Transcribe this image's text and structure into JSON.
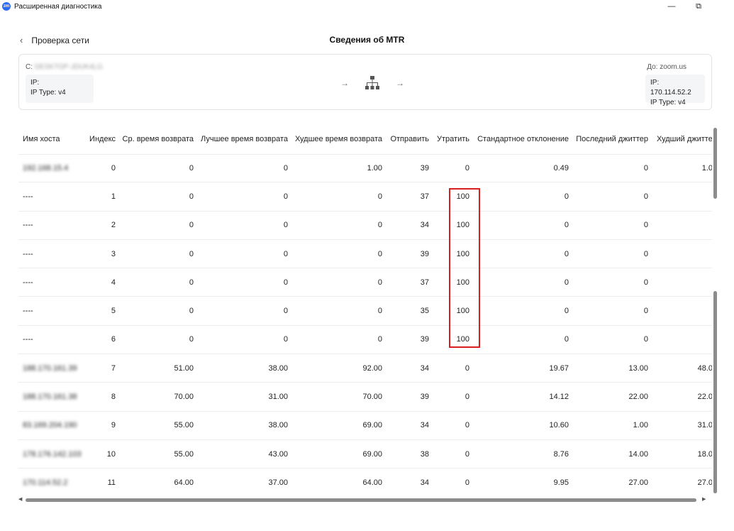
{
  "window": {
    "title": "Расширенная диагностика",
    "app_icon_text": "zm",
    "minimize": "—",
    "restore": "⧉"
  },
  "header": {
    "back_label": "Проверка сети",
    "page_title": "Сведения об MTR"
  },
  "route": {
    "from_prefix": "С:",
    "from_host": "DESKTOP-JDUK4LG",
    "from_ip": "IP:",
    "from_ip_type": "IP Type: v4",
    "to_label": "До: zoom.us",
    "to_ip": "IP: 170.114.52.2",
    "to_ip_type": "IP Type: v4"
  },
  "table": {
    "columns": [
      "Имя хоста",
      "Индекс",
      "Ср. время возврата",
      "Лучшее время возврата",
      "Худшее время возврата",
      "Отправить",
      "Утратить",
      "Стандартное отклонение",
      "Последний джиттер",
      "Худший джитте"
    ],
    "rows": [
      {
        "host": "192.168.15.4",
        "blurred": true,
        "index": "0",
        "avg": "0",
        "best": "0",
        "worst": "1.00",
        "sent": "39",
        "lost": "0",
        "stdev": "0.49",
        "last_jitter": "0",
        "worst_jitter": "1.0"
      },
      {
        "host": "----",
        "blurred": false,
        "index": "1",
        "avg": "0",
        "best": "0",
        "worst": "0",
        "sent": "37",
        "lost": "100",
        "stdev": "0",
        "last_jitter": "0",
        "worst_jitter": ""
      },
      {
        "host": "----",
        "blurred": false,
        "index": "2",
        "avg": "0",
        "best": "0",
        "worst": "0",
        "sent": "34",
        "lost": "100",
        "stdev": "0",
        "last_jitter": "0",
        "worst_jitter": ""
      },
      {
        "host": "----",
        "blurred": false,
        "index": "3",
        "avg": "0",
        "best": "0",
        "worst": "0",
        "sent": "39",
        "lost": "100",
        "stdev": "0",
        "last_jitter": "0",
        "worst_jitter": ""
      },
      {
        "host": "----",
        "blurred": false,
        "index": "4",
        "avg": "0",
        "best": "0",
        "worst": "0",
        "sent": "37",
        "lost": "100",
        "stdev": "0",
        "last_jitter": "0",
        "worst_jitter": ""
      },
      {
        "host": "----",
        "blurred": false,
        "index": "5",
        "avg": "0",
        "best": "0",
        "worst": "0",
        "sent": "35",
        "lost": "100",
        "stdev": "0",
        "last_jitter": "0",
        "worst_jitter": ""
      },
      {
        "host": "----",
        "blurred": false,
        "index": "6",
        "avg": "0",
        "best": "0",
        "worst": "0",
        "sent": "39",
        "lost": "100",
        "stdev": "0",
        "last_jitter": "0",
        "worst_jitter": ""
      },
      {
        "host": "188.170.161.39",
        "blurred": true,
        "index": "7",
        "avg": "51.00",
        "best": "38.00",
        "worst": "92.00",
        "sent": "34",
        "lost": "0",
        "stdev": "19.67",
        "last_jitter": "13.00",
        "worst_jitter": "48.0"
      },
      {
        "host": "188.170.161.38",
        "blurred": true,
        "index": "8",
        "avg": "70.00",
        "best": "31.00",
        "worst": "70.00",
        "sent": "39",
        "lost": "0",
        "stdev": "14.12",
        "last_jitter": "22.00",
        "worst_jitter": "22.0"
      },
      {
        "host": "83.169.204.190",
        "blurred": true,
        "index": "9",
        "avg": "55.00",
        "best": "38.00",
        "worst": "69.00",
        "sent": "34",
        "lost": "0",
        "stdev": "10.60",
        "last_jitter": "1.00",
        "worst_jitter": "31.0"
      },
      {
        "host": "178.176.142.103",
        "blurred": true,
        "index": "10",
        "avg": "55.00",
        "best": "43.00",
        "worst": "69.00",
        "sent": "38",
        "lost": "0",
        "stdev": "8.76",
        "last_jitter": "14.00",
        "worst_jitter": "18.0"
      },
      {
        "host": "170.114.52.2",
        "blurred": true,
        "index": "11",
        "avg": "64.00",
        "best": "37.00",
        "worst": "64.00",
        "sent": "34",
        "lost": "0",
        "stdev": "9.95",
        "last_jitter": "27.00",
        "worst_jitter": "27.0"
      }
    ]
  },
  "colors": {
    "highlight": "#d81e1e",
    "icon_gray": "#555555"
  }
}
